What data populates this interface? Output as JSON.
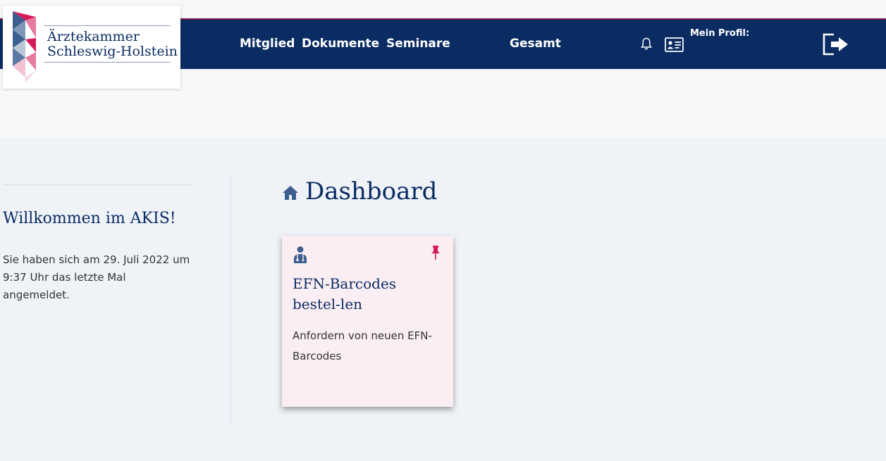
{
  "logo": {
    "line1": "Ärztekammer",
    "line2": "Schleswig-Holstein"
  },
  "nav": {
    "items": [
      {
        "label": "Mitglied"
      },
      {
        "label": "Dokumente"
      },
      {
        "label": "Seminare"
      },
      {
        "label": "Gesamt"
      }
    ]
  },
  "header": {
    "profile_label": "Mein Profil:",
    "icons": [
      "bell-icon",
      "id-card-icon",
      "logout-icon"
    ]
  },
  "sidebar": {
    "welcome_title": "Willkommen im AKIS!",
    "welcome_text": "Sie haben sich am 29. Juli 2022 um 9:37 Uhr das letzte Mal angemeldet."
  },
  "main": {
    "title": "Dashboard",
    "title_icon": "home-icon",
    "cards": [
      {
        "title": "EFN-Barcodes bestel-len",
        "description": "Anfordern von neuen EFN-Barcodes",
        "icon": "doctor-icon",
        "pinned": true
      }
    ]
  },
  "colors": {
    "brand_navy": "#0a2c63",
    "accent_pink": "#d6195b",
    "card_bg": "#fbeef3",
    "page_bg": "#eff2f7"
  }
}
